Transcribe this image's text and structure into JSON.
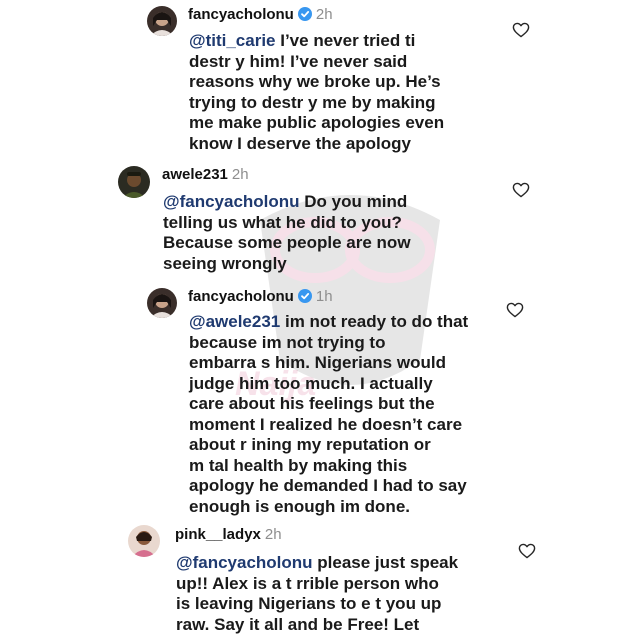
{
  "comments": [
    {
      "username": "fancyacholonu",
      "verified": true,
      "time": "2h",
      "mention": "@titi_carie",
      "lines": [
        " I’ve never tried ti",
        "destr y him! I’ve never said",
        "reasons why we broke up. He’s",
        "trying to destr y me by making",
        "me make public apologies even",
        "know I deserve the apology"
      ]
    },
    {
      "username": "awele231",
      "verified": false,
      "time": "2h",
      "mention": "@fancyacholonu",
      "lines": [
        " Do you mind",
        "telling us what he did to you?",
        "Because some people are now",
        "seeing wrongly"
      ]
    },
    {
      "username": "fancyacholonu",
      "verified": true,
      "time": "1h",
      "mention": "@awele231",
      "lines": [
        " im not ready to do that",
        "because im not trying to",
        "embarra s him. Nigerians would",
        "judge him too much. I actually",
        "care about his feelings but the",
        "moment I realized he doesn’t care",
        "about r ining my reputation or",
        "m  tal health by making this",
        "apology he demanded I had to say",
        "enough is enough im done."
      ]
    },
    {
      "username": "pink__ladyx",
      "verified": false,
      "time": "2h",
      "mention": "@fancyacholonu",
      "lines": [
        " please just speak",
        "up!! Alex is a t rrible person who",
        "is leaving Nigerians to e t you up",
        "raw. Say it all and be Free! Let"
      ]
    }
  ],
  "icons": {
    "like": "heart-outline-icon",
    "verified": "verified-badge-icon"
  },
  "colors": {
    "mention": "#1f3a70",
    "timestamp": "#8e8e8e",
    "verified": "#3897f0"
  }
}
